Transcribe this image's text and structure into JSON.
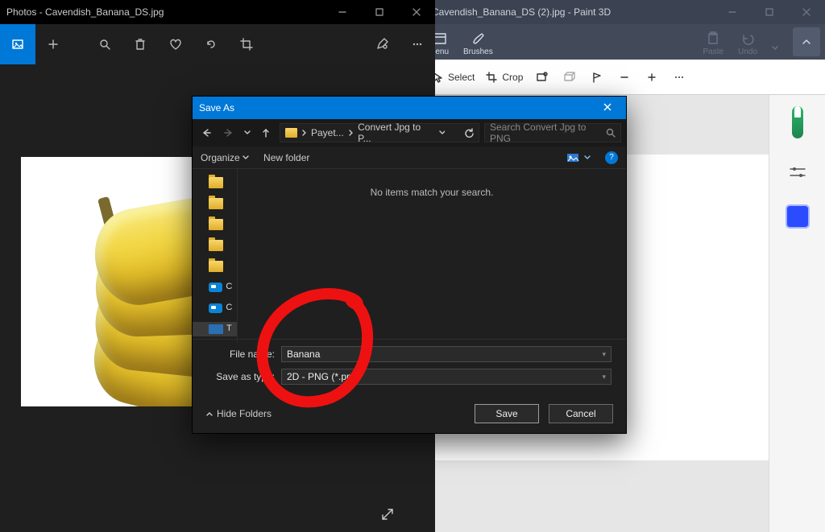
{
  "photos": {
    "title": "Photos - Cavendish_Banana_DS.jpg"
  },
  "paint": {
    "title": "Cavendish_Banana_DS (2).jpg - Paint 3D",
    "menu": "Menu",
    "brushes": "Brushes",
    "paste": "Paste",
    "undo": "Undo",
    "select": "Select",
    "crop": "Crop"
  },
  "dialog": {
    "title": "Save As",
    "breadcrumbs": {
      "b1": "Payet...",
      "b2": "Convert Jpg to P..."
    },
    "search_placeholder": "Search Convert Jpg to PNG",
    "organize": "Organize",
    "new_folder": "New folder",
    "empty": "No items match your search.",
    "tree_onedrive1": "C",
    "tree_onedrive2": "C",
    "tree_thispc": "T",
    "filename_label": "File name:",
    "filename_value": "Banana",
    "savetype_label": "Save as type:",
    "savetype_value": "2D - PNG (*.png)",
    "hide_folders": "Hide Folders",
    "save": "Save",
    "cancel": "Cancel",
    "help": "?"
  }
}
